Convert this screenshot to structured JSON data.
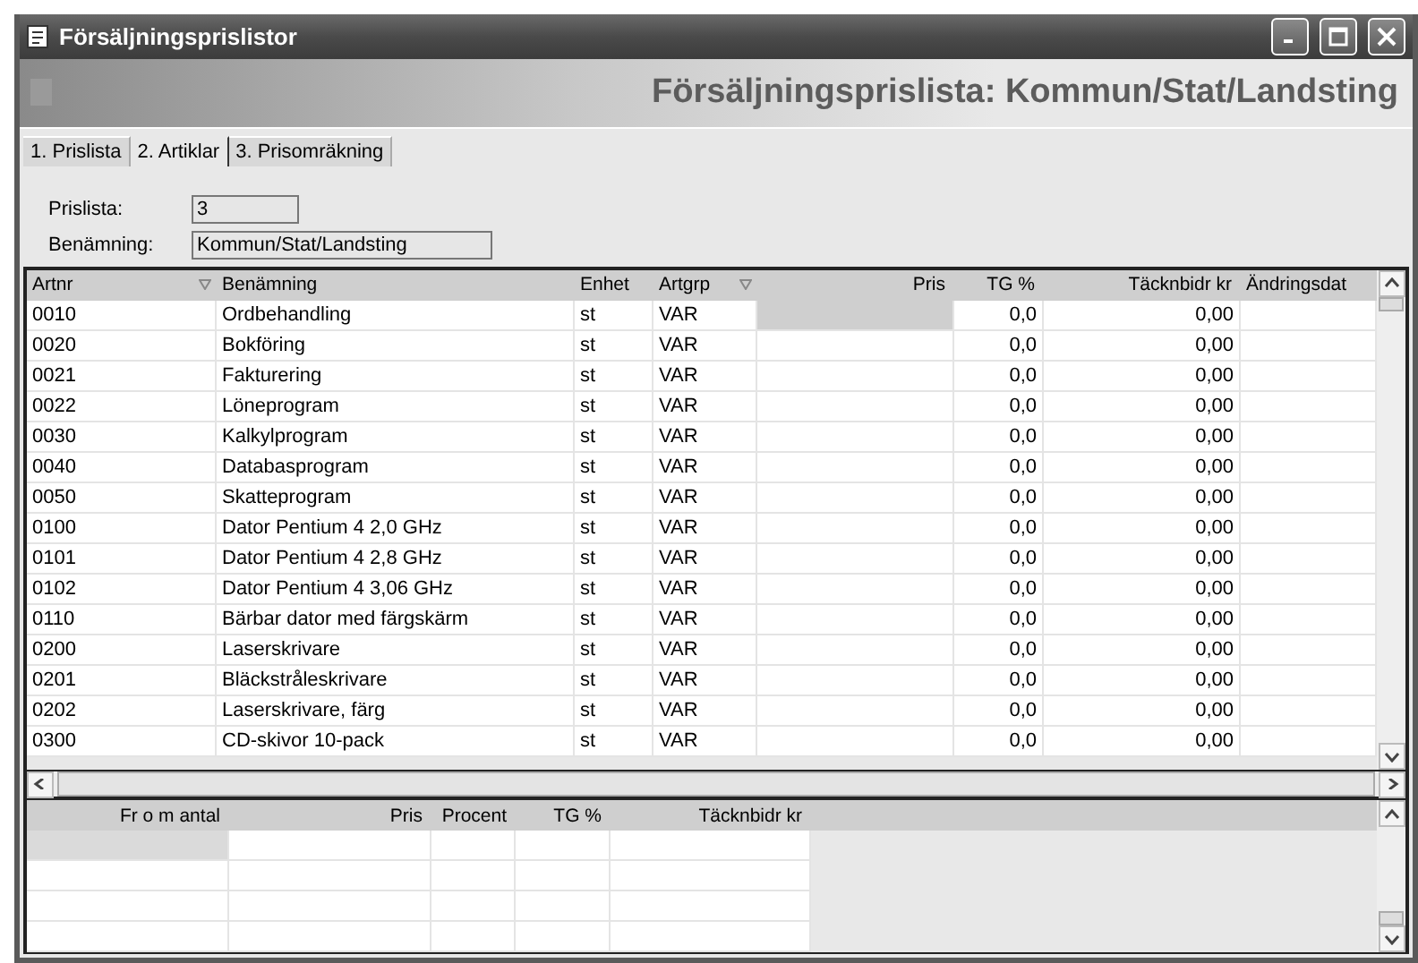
{
  "window": {
    "title": "Försäljningsprislistor"
  },
  "header": {
    "title": "Försäljningsprislista: Kommun/Stat/Landsting"
  },
  "tabs": [
    {
      "label": "1. Prislista",
      "selected": false
    },
    {
      "label": "2. Artiklar",
      "selected": true
    },
    {
      "label": "3. Prisomräkning",
      "selected": false
    }
  ],
  "fields": [
    {
      "label": "Prislista:",
      "value": "3"
    },
    {
      "label": "Benämning:",
      "value": "Kommun/Stat/Landsting"
    }
  ],
  "table": {
    "columns": [
      {
        "label": "Artnr",
        "sorted": true
      },
      {
        "label": "Benämning",
        "sorted": false
      },
      {
        "label": "Enhet",
        "sorted": false
      },
      {
        "label": "Artgrp",
        "sorted": true
      },
      {
        "label": "Pris",
        "sorted": false
      },
      {
        "label": "TG %",
        "sorted": false
      },
      {
        "label": "Täcknbidr kr",
        "sorted": false
      },
      {
        "label": "Ändringsdat",
        "sorted": false
      }
    ],
    "rows": [
      {
        "selected": true,
        "cells": [
          "0010",
          "Ordbehandling",
          "st",
          "VAR",
          "",
          "0,0",
          "0,00",
          ""
        ]
      },
      {
        "selected": false,
        "cells": [
          "0020",
          "Bokföring",
          "st",
          "VAR",
          "",
          "0,0",
          "0,00",
          ""
        ]
      },
      {
        "selected": false,
        "cells": [
          "0021",
          "Fakturering",
          "st",
          "VAR",
          "",
          "0,0",
          "0,00",
          ""
        ]
      },
      {
        "selected": false,
        "cells": [
          "0022",
          "Löneprogram",
          "st",
          "VAR",
          "",
          "0,0",
          "0,00",
          ""
        ]
      },
      {
        "selected": false,
        "cells": [
          "0030",
          "Kalkylprogram",
          "st",
          "VAR",
          "",
          "0,0",
          "0,00",
          ""
        ]
      },
      {
        "selected": false,
        "cells": [
          "0040",
          "Databasprogram",
          "st",
          "VAR",
          "",
          "0,0",
          "0,00",
          ""
        ]
      },
      {
        "selected": false,
        "cells": [
          "0050",
          "Skatteprogram",
          "st",
          "VAR",
          "",
          "0,0",
          "0,00",
          ""
        ]
      },
      {
        "selected": false,
        "cells": [
          "0100",
          "Dator Pentium 4 2,0 GHz",
          "st",
          "VAR",
          "",
          "0,0",
          "0,00",
          ""
        ]
      },
      {
        "selected": false,
        "cells": [
          "0101",
          "Dator Pentium 4 2,8 GHz",
          "st",
          "VAR",
          "",
          "0,0",
          "0,00",
          ""
        ]
      },
      {
        "selected": false,
        "cells": [
          "0102",
          "Dator Pentium 4 3,06 GHz",
          "st",
          "VAR",
          "",
          "0,0",
          "0,00",
          ""
        ]
      },
      {
        "selected": false,
        "cells": [
          "0110",
          "Bärbar dator med färgskärm",
          "st",
          "VAR",
          "",
          "0,0",
          "0,00",
          ""
        ]
      },
      {
        "selected": false,
        "cells": [
          "0200",
          "Laserskrivare",
          "st",
          "VAR",
          "",
          "0,0",
          "0,00",
          ""
        ]
      },
      {
        "selected": false,
        "cells": [
          "0201",
          "Bläckstråleskrivare",
          "st",
          "VAR",
          "",
          "0,0",
          "0,00",
          ""
        ]
      },
      {
        "selected": false,
        "cells": [
          "0202",
          "Laserskrivare, färg",
          "st",
          "VAR",
          "",
          "0,0",
          "0,00",
          ""
        ]
      },
      {
        "selected": false,
        "cells": [
          "0300",
          "CD-skivor 10-pack",
          "st",
          "VAR",
          "",
          "0,0",
          "0,00",
          ""
        ]
      }
    ]
  },
  "detail_table": {
    "columns": [
      "Fr o m antal",
      "Pris",
      "Procent",
      "TG %",
      "Täcknbidr kr"
    ],
    "rows": [
      {
        "selected": true
      },
      {
        "selected": false
      },
      {
        "selected": false
      },
      {
        "selected": false
      }
    ]
  }
}
